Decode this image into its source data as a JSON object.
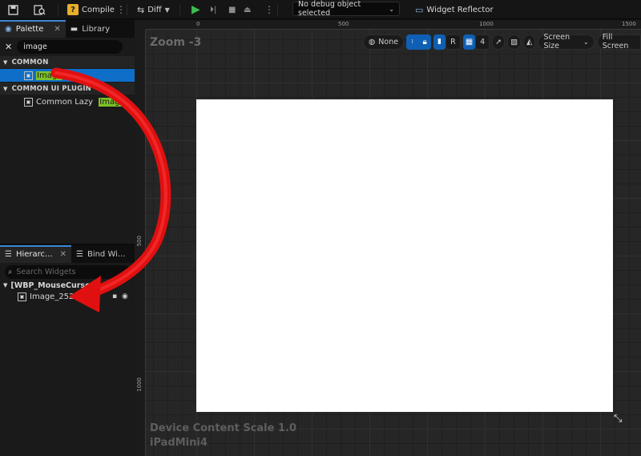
{
  "toolbar": {
    "save_icon": "save-icon",
    "browse_icon": "browse-icon",
    "compile_label": "Compile",
    "diff_label": "Diff",
    "debug_selector": "No debug object selected",
    "widget_reflector": "Widget Reflector"
  },
  "palette": {
    "tab_label": "Palette",
    "library_tab_label": "Library",
    "search_value": "image",
    "category_common": "COMMON",
    "item_image": "Image",
    "category_common_ui": "COMMON UI PLUGIN",
    "item_common_lazy_prefix": "Common Lazy ",
    "item_common_lazy_match": "Image"
  },
  "hierarchy": {
    "tab_label": "Hierarc...",
    "bind_tab_label": "Bind Wi...",
    "search_placeholder": "Search Widgets",
    "root": "[WBP_MouseCursor]",
    "child": "Image_252"
  },
  "viewport": {
    "zoom_label": "Zoom -3",
    "ruler_top": [
      "0",
      "500",
      "1000",
      "1500"
    ],
    "ruler_left": [
      "500",
      "1000"
    ],
    "none_label": "None",
    "r_label": "R",
    "grid_value": "4",
    "screen_size_label": "Screen Size",
    "fill_screen_label": "Fill Screen",
    "device_content_scale": "Device Content Scale 1.0",
    "device_name": "iPadMini4"
  },
  "colors": {
    "selection_blue": "#0e6ec8",
    "highlight_green": "#7ec227",
    "arrow_red": "#e01010",
    "play_green": "#3fb950"
  }
}
